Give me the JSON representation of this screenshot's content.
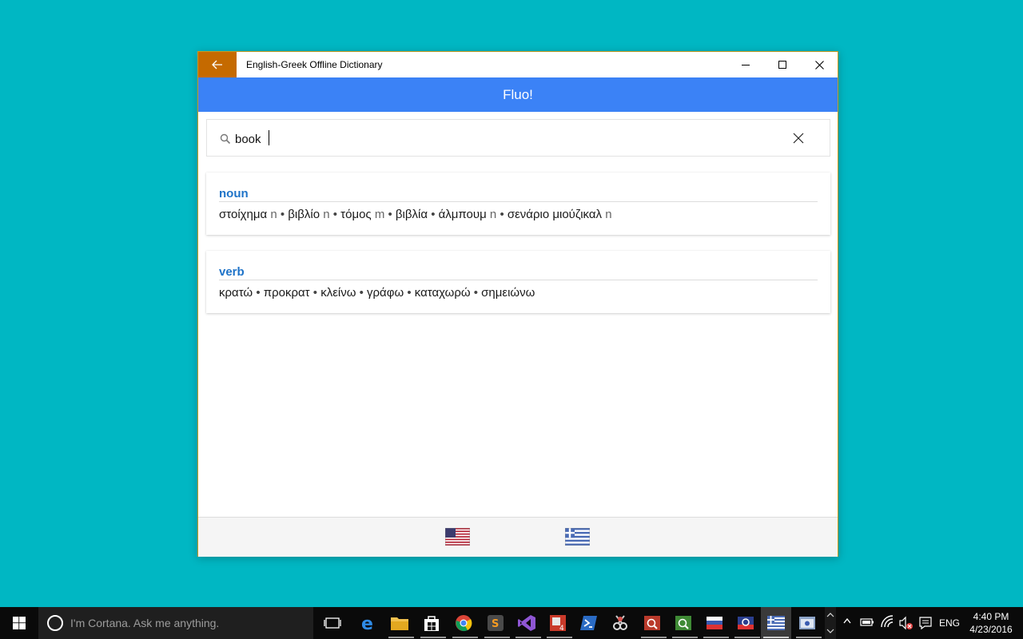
{
  "window": {
    "title": "English-Greek Offline Dictionary",
    "header": "Fluo!",
    "accent_color": "#3b82f6",
    "back_color": "#c56a00"
  },
  "search": {
    "value": "book",
    "placeholder": ""
  },
  "results": [
    {
      "pos": "noun",
      "terms": [
        {
          "word": "στοίχημα",
          "gender": "n"
        },
        {
          "word": "βιβλίο",
          "gender": "n"
        },
        {
          "word": "τόμος",
          "gender": "m"
        },
        {
          "word": "βιβλία",
          "gender": ""
        },
        {
          "word": "άλμπουμ",
          "gender": "n"
        },
        {
          "word": "σενάριο μιούζικαλ",
          "gender": "n"
        }
      ]
    },
    {
      "pos": "verb",
      "terms": [
        {
          "word": "κρατώ",
          "gender": ""
        },
        {
          "word": "προκρατ",
          "gender": ""
        },
        {
          "word": "κλείνω",
          "gender": ""
        },
        {
          "word": "γράφω",
          "gender": ""
        },
        {
          "word": "καταχωρώ",
          "gender": ""
        },
        {
          "word": "σημειώνω",
          "gender": ""
        }
      ]
    }
  ],
  "footer": {
    "source_flag": "us-flag-icon",
    "target_flag": "greece-flag-icon"
  },
  "taskbar": {
    "cortana_text": "I'm Cortana. Ask me anything.",
    "language": "ENG",
    "time": "4:40 PM",
    "date": "4/23/2016"
  }
}
